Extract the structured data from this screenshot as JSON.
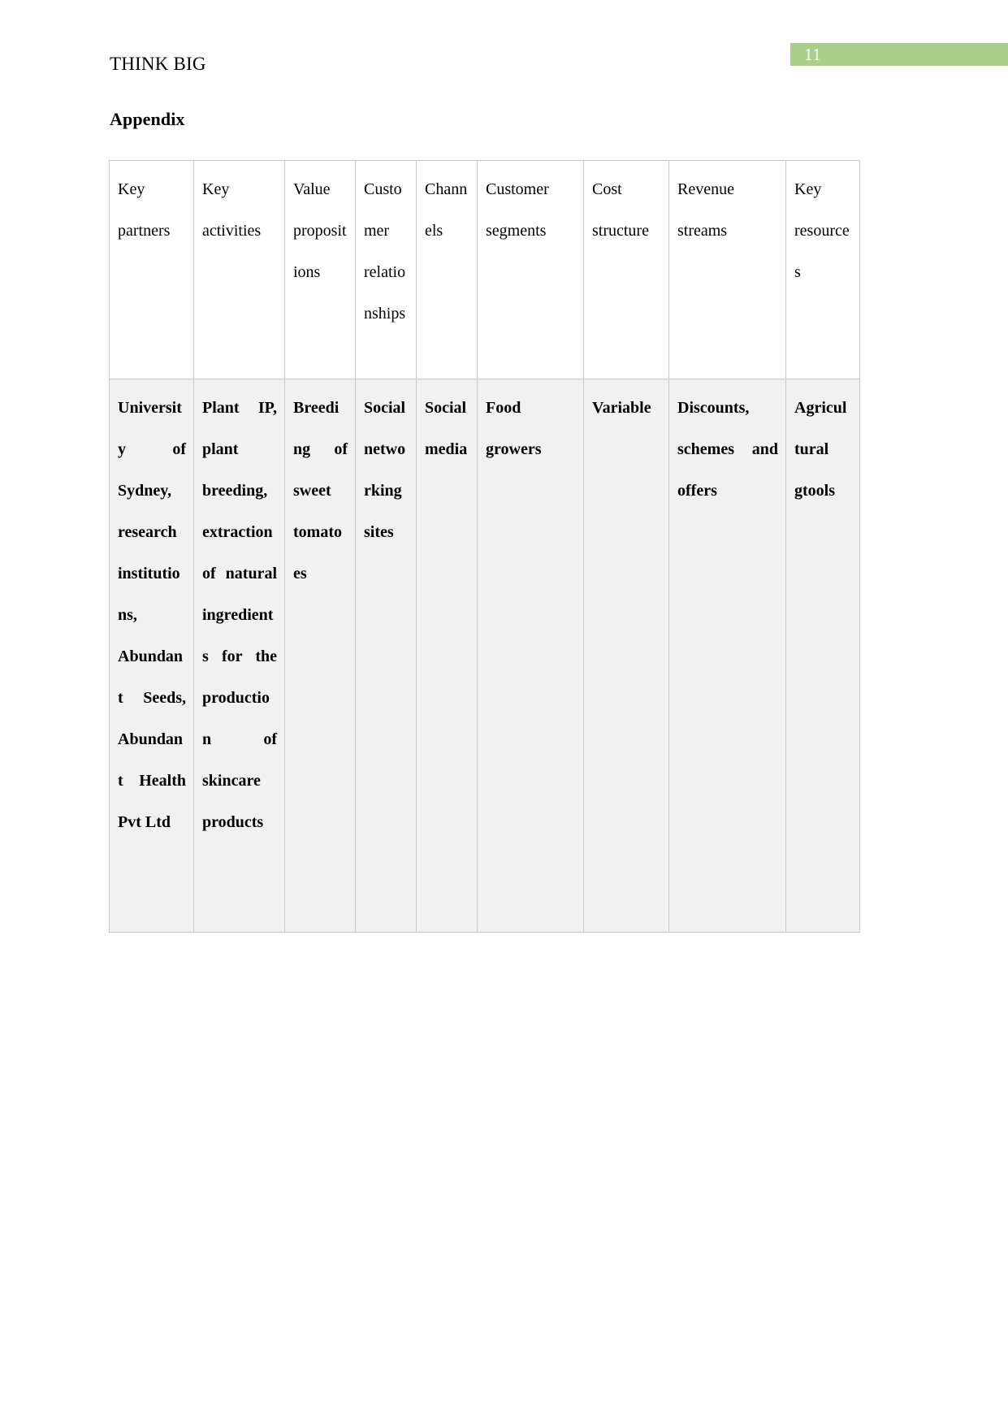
{
  "page": {
    "number": "11",
    "badge_color": "#a9cf8a",
    "badge_text_color": "#ffffff",
    "running_header": "THINK BIG",
    "section_title": "Appendix"
  },
  "table": {
    "row_background": "#f1f1f1",
    "border_color": "#c8c8c8",
    "headers": [
      "Key partners",
      "Key activities",
      "Value propositions",
      "Customer relationships",
      "Channels",
      "Customer segments",
      "Cost structure",
      "Revenue streams",
      "Key resources"
    ],
    "rows": [
      [
        "University of Sydney, research institutions, Abundant Seeds, Abundant Health Pvt Ltd",
        "Plant IP, plant breeding, extraction of natural ingredients for the production of skincare products",
        "Breeding of sweet tomatoes",
        "Social networking sites",
        "Social media",
        "Food growers",
        "Variable",
        "Discounts, schemes and offers",
        "Agricultural gtools"
      ]
    ]
  }
}
